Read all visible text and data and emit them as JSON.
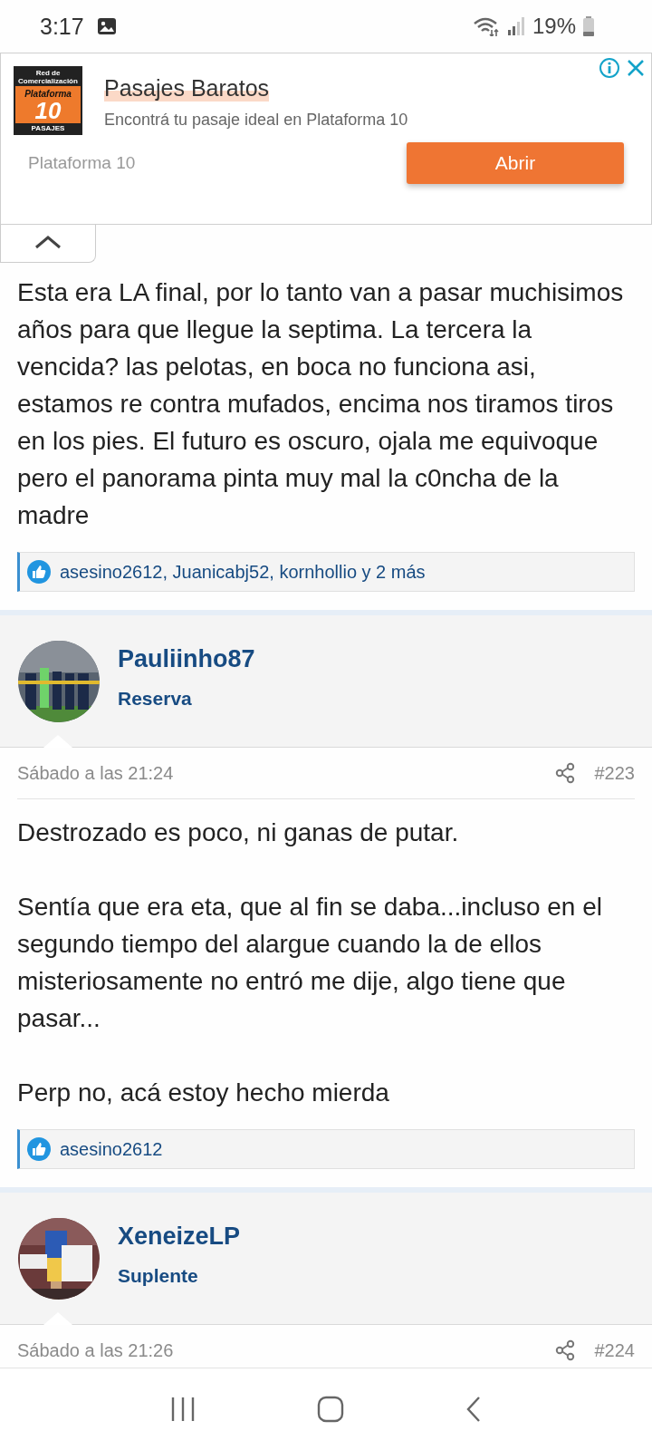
{
  "status_bar": {
    "time": "3:17",
    "battery": "19%"
  },
  "ad": {
    "logo": {
      "top": "Red de Comercialización",
      "brand": "Plataforma",
      "number": "10",
      "bottom": "PASAJES"
    },
    "title": "Pasajes Baratos",
    "subtitle": "Encontrá tu pasaje ideal en Plataforma 10",
    "advertiser": "Plataforma 10",
    "button": "Abrir"
  },
  "posts": [
    {
      "kind": "body",
      "paragraphs": [
        "Esta era LA final, por lo tanto van a pasar muchisimos años para que llegue la septima. La tercera la vencida? las pelotas, en boca no funciona asi, estamos re contra mufados, encima nos tiramos tiros en los pies. El futuro es oscuro, ojala me equivoque pero el panorama pinta muy mal la c0ncha de la madre"
      ],
      "likes": "asesino2612, Juanicabj52, kornhollio y 2 más"
    },
    {
      "kind": "full",
      "user": "Pauliinho87",
      "rank": "Reserva",
      "date": "Sábado a las 21:24",
      "number": "#223",
      "paragraphs": [
        "Destrozado es poco, ni ganas de putar.",
        "Sentía que era eta, que al fin se daba...incluso en el segundo tiempo del alargue cuando la de ellos misteriosamente no entró me dije, algo tiene que pasar...",
        "Perp no, acá estoy hecho mierda"
      ],
      "likes": "asesino2612"
    },
    {
      "kind": "header",
      "user": "XeneizeLP",
      "rank": "Suplente",
      "date": "Sábado a las 21:26",
      "number": "#224"
    }
  ]
}
